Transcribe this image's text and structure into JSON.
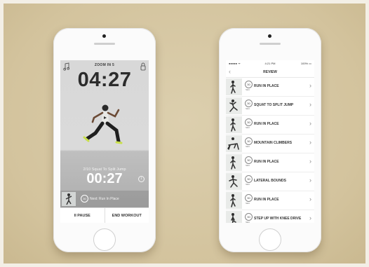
{
  "left_phone": {
    "zoom_label": "ZOOM IN 5",
    "main_timer": "04:27",
    "current_exercise": "2/10 Squat To Split Jump",
    "exercise_timer": "00:27",
    "next_label": "Next: Run In Place",
    "next_count": "30",
    "buttons": {
      "pause": "II PAUSE",
      "end": "END WORKOUT"
    },
    "icons": {
      "music": "music-note-icon",
      "lock": "lock-icon",
      "info": "info-icon"
    }
  },
  "right_phone": {
    "status": {
      "carrier": "●●●●● ᯤ",
      "time": "4:21 PM",
      "battery": "100% ▭"
    },
    "title": "REVIEW",
    "back_glyph": "‹",
    "unit_label": "SEC",
    "items": [
      {
        "count": "30",
        "name": "RUN IN PLACE"
      },
      {
        "count": "30",
        "name": "SQUAT TO SPLIT JUMP"
      },
      {
        "count": "30",
        "name": "RUN IN PLACE"
      },
      {
        "count": "30",
        "name": "MOUNTAIN CLIMBERS"
      },
      {
        "count": "30",
        "name": "RUN IN PLACE"
      },
      {
        "count": "30",
        "name": "LATERAL BOUNDS"
      },
      {
        "count": "30",
        "name": "RUN IN PLACE"
      },
      {
        "count": "30",
        "name": "STEP UP WITH KNEE DRIVE"
      }
    ],
    "chevron": "›"
  },
  "colors": {
    "background": "#d6c7a3",
    "phone_body": "#fbfbfb",
    "text_dark": "#2c2c2c"
  }
}
